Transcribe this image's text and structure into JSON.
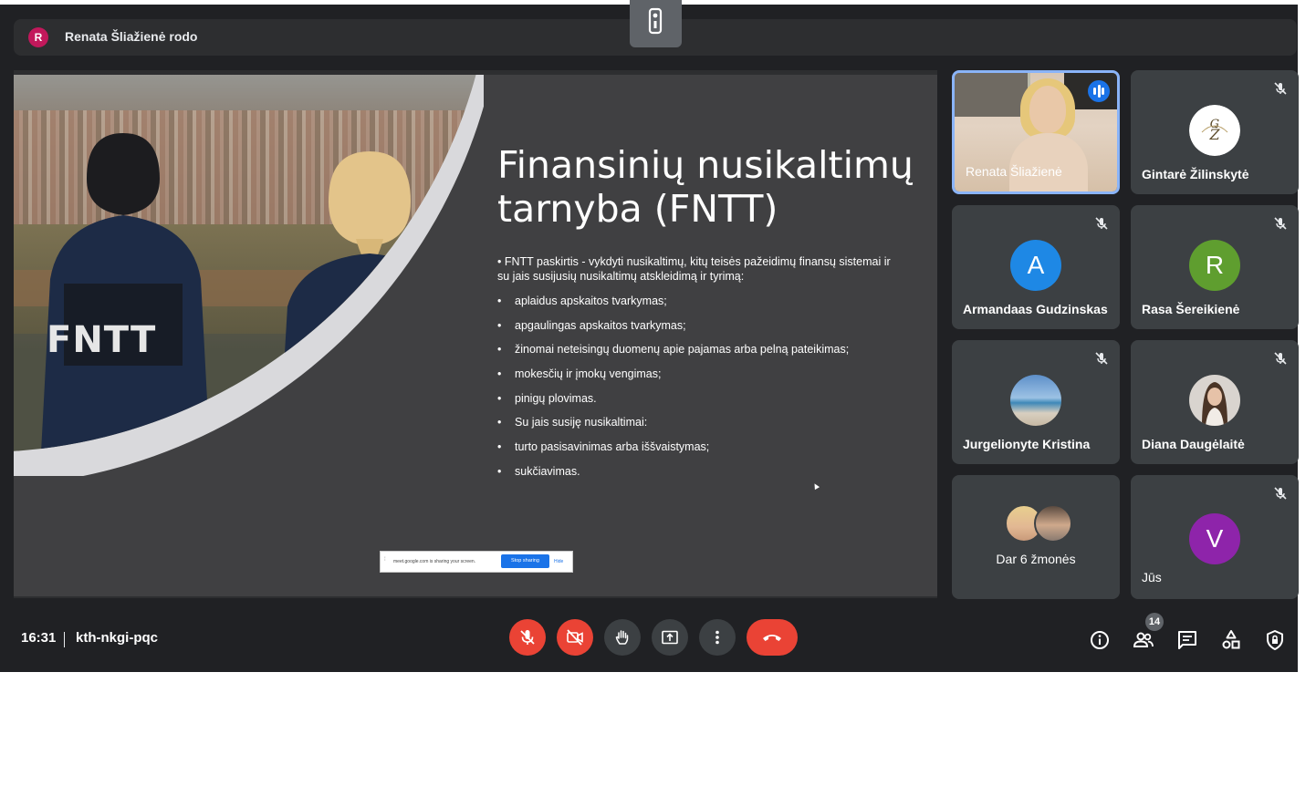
{
  "top_bar": {
    "presenter_initial": "R",
    "presenter_text": "Renata Šliažienė rodo"
  },
  "slide": {
    "photo_text": "FNTT",
    "title": "Finansinių nusikaltimų tarnyba (FNTT)",
    "intro": "•   FNTT paskirtis - vykdyti nusikaltimų, kitų teisės pažeidimų finansų sistemai ir su jais susijusių nusikaltimų atskleidimą ir tyrimą:",
    "bullets": [
      "aplaidus apskaitos tvarkymas;",
      "apgaulingas apskaitos tvarkymas;",
      "žinomai neteisingų duomenų apie pajamas arba pelną pateikimas;",
      "mokesčių ir įmokų vengimas;",
      "pinigų plovimas.",
      " Su jais susiję nusikaltimai:",
      "turto pasisavinimas arba iššvaistymas;",
      "sukčiavimas."
    ],
    "share_bar": {
      "message": "meet.google.com is sharing your screen.",
      "stop_label": "Stop sharing",
      "hide_label": "Hide"
    }
  },
  "participants": [
    {
      "name": "Renata Šliažienė",
      "type": "video",
      "speaking": true
    },
    {
      "name": "Gintarė Žilinskytė",
      "type": "logo",
      "muted": true
    },
    {
      "name": "Armandaas Gudzinskas",
      "type": "initial",
      "initial": "A",
      "color": "#1e88e5",
      "muted": true
    },
    {
      "name": "Rasa Šereikienė",
      "type": "initial",
      "initial": "R",
      "color": "#5f9e2f",
      "muted": true
    },
    {
      "name": "Jurgelionyte Kristina",
      "type": "photo",
      "muted": true
    },
    {
      "name": "Diana Daugėlaitė",
      "type": "photo",
      "muted": true
    },
    {
      "name": "Dar 6 žmonės",
      "type": "more"
    },
    {
      "name": "Jūs",
      "type": "initial",
      "initial": "V",
      "color": "#8e24aa",
      "muted": true
    }
  ],
  "bottom_bar": {
    "time": "16:31",
    "meeting_code": "kth-nkgi-pqc",
    "participant_count": "14"
  },
  "colors": {
    "background": "#202124",
    "surface": "#3c4043",
    "danger": "#ea4335",
    "speaking": "#1a73e8"
  },
  "icons": [
    "cast-icon",
    "mic-off-icon",
    "camera-off-icon",
    "hand-icon",
    "present-icon",
    "more-vert-icon",
    "call-end-icon",
    "info-icon",
    "people-icon",
    "chat-icon",
    "activities-icon",
    "host-controls-icon"
  ]
}
